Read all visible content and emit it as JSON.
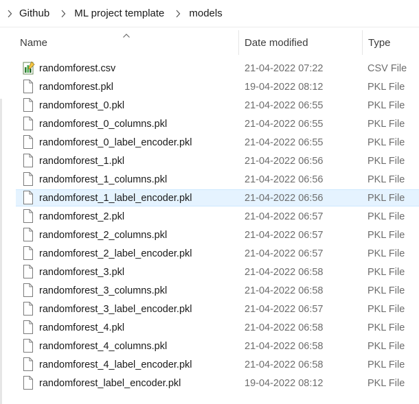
{
  "breadcrumb": [
    "Github",
    "ML project template",
    "models"
  ],
  "columns": {
    "name": "Name",
    "date_modified": "Date modified",
    "type": "Type"
  },
  "files": [
    {
      "name": "randomforest.csv",
      "date": "21-04-2022 07:22",
      "type": "CSV File",
      "icon": "csv-file-icon"
    },
    {
      "name": "randomforest.pkl",
      "date": "19-04-2022 08:12",
      "type": "PKL File",
      "icon": "file-icon"
    },
    {
      "name": "randomforest_0.pkl",
      "date": "21-04-2022 06:55",
      "type": "PKL File",
      "icon": "file-icon"
    },
    {
      "name": "randomforest_0_columns.pkl",
      "date": "21-04-2022 06:55",
      "type": "PKL File",
      "icon": "file-icon"
    },
    {
      "name": "randomforest_0_label_encoder.pkl",
      "date": "21-04-2022 06:55",
      "type": "PKL File",
      "icon": "file-icon"
    },
    {
      "name": "randomforest_1.pkl",
      "date": "21-04-2022 06:56",
      "type": "PKL File",
      "icon": "file-icon"
    },
    {
      "name": "randomforest_1_columns.pkl",
      "date": "21-04-2022 06:56",
      "type": "PKL File",
      "icon": "file-icon"
    },
    {
      "name": "randomforest_1_label_encoder.pkl",
      "date": "21-04-2022 06:56",
      "type": "PKL File",
      "icon": "file-icon",
      "selected": true
    },
    {
      "name": "randomforest_2.pkl",
      "date": "21-04-2022 06:57",
      "type": "PKL File",
      "icon": "file-icon"
    },
    {
      "name": "randomforest_2_columns.pkl",
      "date": "21-04-2022 06:57",
      "type": "PKL File",
      "icon": "file-icon"
    },
    {
      "name": "randomforest_2_label_encoder.pkl",
      "date": "21-04-2022 06:57",
      "type": "PKL File",
      "icon": "file-icon"
    },
    {
      "name": "randomforest_3.pkl",
      "date": "21-04-2022 06:58",
      "type": "PKL File",
      "icon": "file-icon"
    },
    {
      "name": "randomforest_3_columns.pkl",
      "date": "21-04-2022 06:58",
      "type": "PKL File",
      "icon": "file-icon"
    },
    {
      "name": "randomforest_3_label_encoder.pkl",
      "date": "21-04-2022 06:57",
      "type": "PKL File",
      "icon": "file-icon"
    },
    {
      "name": "randomforest_4.pkl",
      "date": "21-04-2022 06:58",
      "type": "PKL File",
      "icon": "file-icon"
    },
    {
      "name": "randomforest_4_columns.pkl",
      "date": "21-04-2022 06:58",
      "type": "PKL File",
      "icon": "file-icon"
    },
    {
      "name": "randomforest_4_label_encoder.pkl",
      "date": "21-04-2022 06:58",
      "type": "PKL File",
      "icon": "file-icon"
    },
    {
      "name": "randomforest_label_encoder.pkl",
      "date": "19-04-2022 08:12",
      "type": "PKL File",
      "icon": "file-icon"
    }
  ],
  "colors": {
    "selection_bg": "#e5f3ff",
    "selection_border": "#cce8ff",
    "secondary_text": "#6d6d6d"
  }
}
